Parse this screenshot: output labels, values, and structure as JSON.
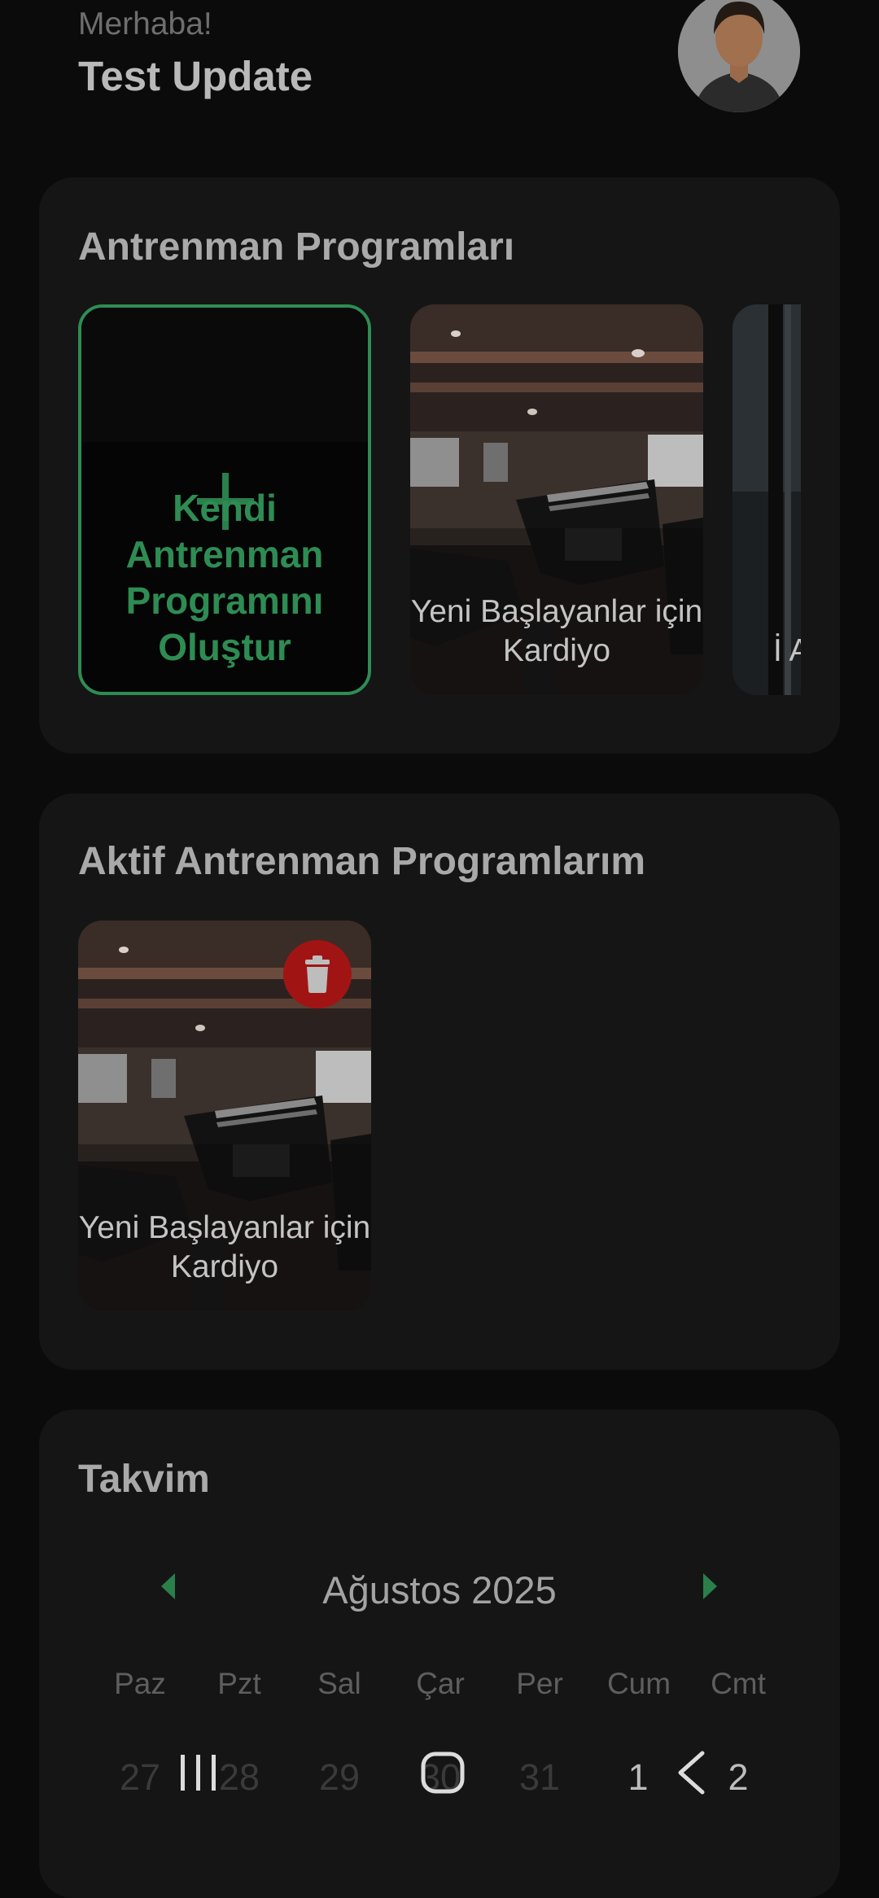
{
  "header": {
    "greeting": "Merhaba!",
    "user_name": "Test Update"
  },
  "programs": {
    "title": "Antrenman Programları",
    "create_label": "Kendi Antrenman Programını Oluştur",
    "items": [
      {
        "label": "Yeni Başlayanlar için Kardiyo"
      },
      {
        "label": "İ Ar"
      }
    ]
  },
  "active_programs": {
    "title": "Aktif Antrenman Programlarım",
    "items": [
      {
        "label": "Yeni Başlayanlar için Kardiyo"
      }
    ]
  },
  "calendar": {
    "title": "Takvim",
    "month": "Ağustos 2025",
    "weekdays": [
      "Paz",
      "Pzt",
      "Sal",
      "Çar",
      "Per",
      "Cum",
      "Cmt"
    ],
    "days": [
      "27",
      "28",
      "29",
      "30",
      "31",
      "1",
      "2"
    ]
  },
  "colors": {
    "accent": "#2e8c53",
    "danger": "#a11414",
    "card": "#151515",
    "background": "#0b0b0b"
  },
  "icons": [
    "plus-icon",
    "trash-icon",
    "chevron-left-icon",
    "chevron-right-icon",
    "nav-recents-icon",
    "nav-home-icon",
    "nav-back-icon"
  ]
}
